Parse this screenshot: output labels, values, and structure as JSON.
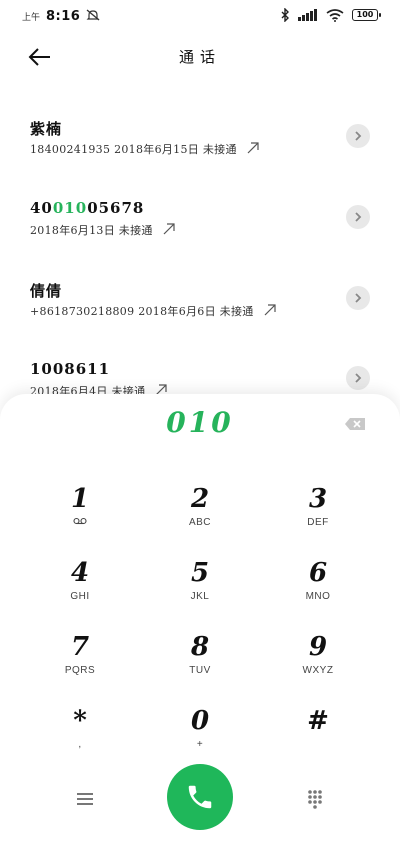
{
  "status": {
    "ampm": "上午",
    "time": "8:16",
    "battery": "100"
  },
  "header": {
    "title": "通话"
  },
  "calls": [
    {
      "name": "紫楠",
      "detail": "18400241935 2018年6月15日 未接通"
    },
    {
      "name_prefix": "40",
      "name_highlight": "010",
      "name_suffix": "05678",
      "detail": "2018年6月13日 未接通"
    },
    {
      "name": "倩倩",
      "detail": "+8618730218809 2018年6月6日 未接通"
    },
    {
      "name": "1008611",
      "detail": "2018年6月4日 未接通"
    }
  ],
  "dialer": {
    "number": "010",
    "keys": [
      {
        "digit": "1",
        "letters": "voicemail-icon"
      },
      {
        "digit": "2",
        "letters": "ABC"
      },
      {
        "digit": "3",
        "letters": "DEF"
      },
      {
        "digit": "4",
        "letters": "GHI"
      },
      {
        "digit": "5",
        "letters": "JKL"
      },
      {
        "digit": "6",
        "letters": "MNO"
      },
      {
        "digit": "7",
        "letters": "PQRS"
      },
      {
        "digit": "8",
        "letters": "TUV"
      },
      {
        "digit": "9",
        "letters": "WXYZ"
      },
      {
        "digit": "*",
        "letters": ","
      },
      {
        "digit": "0",
        "letters": "+"
      },
      {
        "digit": "#",
        "letters": ""
      }
    ]
  },
  "colors": {
    "accent": "#26b35b",
    "call_button": "#1fb75a"
  }
}
